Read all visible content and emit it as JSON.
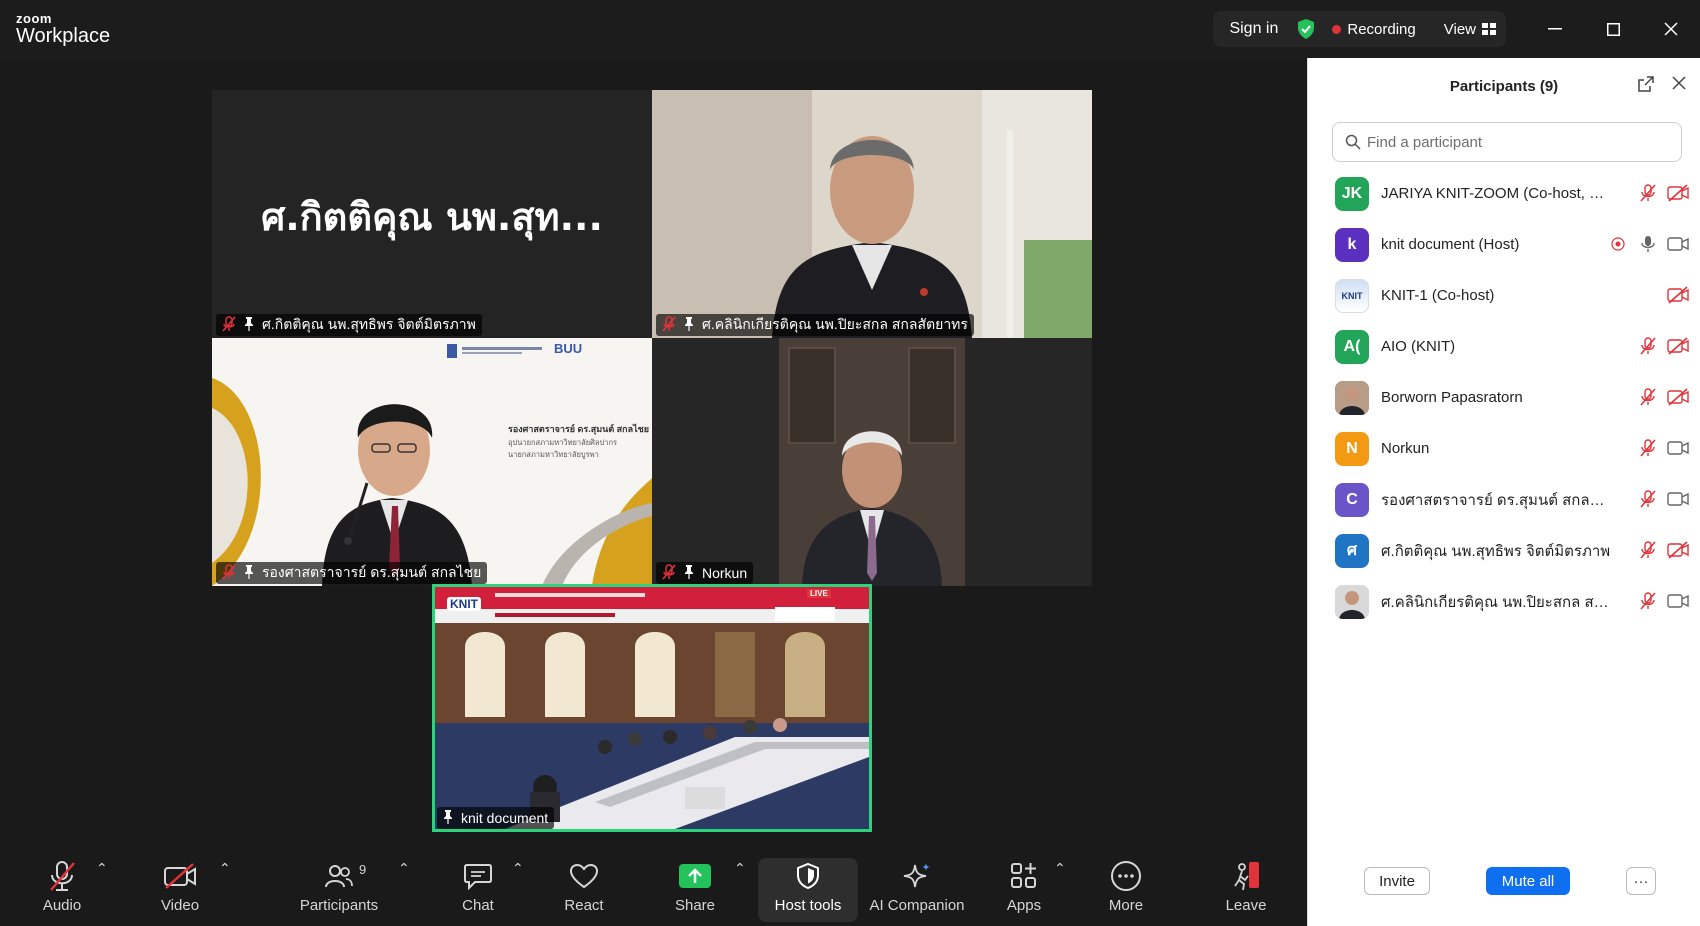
{
  "app": {
    "brand_top": "zoom",
    "brand_bottom": "Workplace",
    "sign_in": "Sign in",
    "recording": "Recording",
    "view": "View"
  },
  "tiles": [
    {
      "name": "ศ.กิตติคุณ นพ.สุทธิพร  จิตต์มิตรภาพ",
      "big_name": "ศ.กิตติคุณ นพ.สุท..."
    },
    {
      "name": "ศ.คลินิกเกียรติคุณ นพ.ปิยะสกล  สกลสัตยาทร"
    },
    {
      "name": "รองศาสตราจารย์ ดร.สุมนต์ สกลไชย",
      "slide_title": "รองศาสตราจารย์ ดร.สุมนต์ สกลไชย",
      "slide_line1": "อุปนายกสภามหาวิทยาลัยศิลปากร",
      "slide_line2": "นายกสภามหาวิทยาลัยบูรพา",
      "slide_logo": "BUU"
    },
    {
      "name": "Norkun"
    },
    {
      "name": "knit document",
      "banner_logo": "KNIT",
      "banner_live": "LIVE"
    }
  ],
  "toolbar": {
    "audio": "Audio",
    "video": "Video",
    "participants": "Participants",
    "participants_count": "9",
    "chat": "Chat",
    "react": "React",
    "share": "Share",
    "host_tools": "Host tools",
    "ai_companion": "AI Companion",
    "apps": "Apps",
    "more": "More",
    "leave": "Leave"
  },
  "panel": {
    "title": "Participants (9)",
    "search_placeholder": "Find a participant",
    "invite": "Invite",
    "mute_all": "Mute all",
    "more": "···",
    "participants": [
      {
        "initials": "JK",
        "color": "#23a559",
        "name": "JARIYA KNIT-ZOOM (Co-host, me)",
        "mic": "muted",
        "cam": "off"
      },
      {
        "initials": "k",
        "color": "#5b2fbf",
        "name": "knit document (Host)",
        "mic": "on",
        "cam": "on",
        "recording": true
      },
      {
        "initials": "KNIT",
        "color": "#ffffff",
        "name": "KNIT-1 (Co-host)",
        "mic": "none",
        "cam": "off"
      },
      {
        "initials": "A(",
        "color": "#23a559",
        "name": "AIO (KNIT)",
        "mic": "muted",
        "cam": "off"
      },
      {
        "initials": "",
        "color": "#6b5a4e",
        "name": "Borworn Papasratorn",
        "mic": "muted",
        "cam": "off"
      },
      {
        "initials": "N",
        "color": "#f39a12",
        "name": "Norkun",
        "mic": "muted",
        "cam": "on"
      },
      {
        "initials": "C",
        "color": "#6a55c8",
        "name": "รองศาสตราจารย์ ดร.สุมนต์ สกลไชย",
        "mic": "muted",
        "cam": "on"
      },
      {
        "initials": "ศ",
        "color": "#1f74c4",
        "name": "ศ.กิตติคุณ นพ.สุทธิพร  จิตต์มิตรภาพ",
        "mic": "muted",
        "cam": "off"
      },
      {
        "initials": "",
        "color": "#888888",
        "name": "ศ.คลินิกเกียรติคุณ นพ.ปิยะสกล  สกลสั...",
        "mic": "muted",
        "cam": "on"
      }
    ]
  },
  "colors": {
    "accent_blue": "#0e6ff0",
    "active_speaker": "#2bd47a",
    "muted_red": "#e0333a",
    "share_green": "#23c25a"
  }
}
